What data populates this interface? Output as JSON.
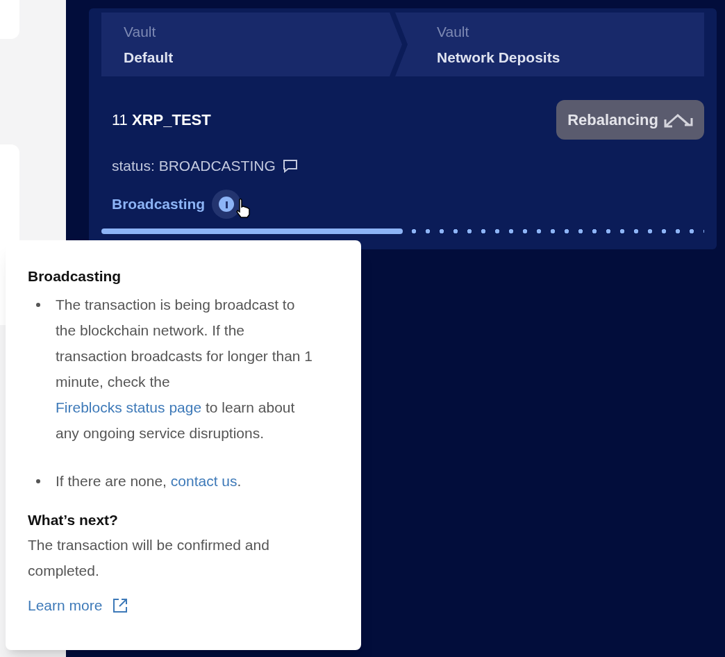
{
  "transfer": {
    "steps": [
      {
        "label": "Vault",
        "name": "Default"
      },
      {
        "label": "Vault",
        "name": "Network Deposits"
      }
    ],
    "amount": "11",
    "asset": "XRP_TEST",
    "tag": "Rebalancing",
    "status": "status: BROADCASTING",
    "stage": "Broadcasting",
    "progress": {
      "level": 0.5
    }
  },
  "tooltip": {
    "title": "Broadcasting",
    "bullets": [
      [
        {
          "kind": "text",
          "text": "The transaction is being broadcast to the blockchain network. If the transaction broadcasts for longer than 1 minute, check the "
        },
        {
          "kind": "link",
          "text": "Fireblocks status page"
        },
        {
          "kind": "text",
          "text": " to learn about any ongoing service disruptions."
        }
      ],
      [
        {
          "kind": "text",
          "text": "If there are none, "
        },
        {
          "kind": "link",
          "text": "contact us"
        },
        {
          "kind": "text",
          "text": "."
        }
      ]
    ],
    "next_title": "What’s next?",
    "next_text": "The transaction will be confirmed and completed.",
    "learn_more": "Learn more"
  }
}
